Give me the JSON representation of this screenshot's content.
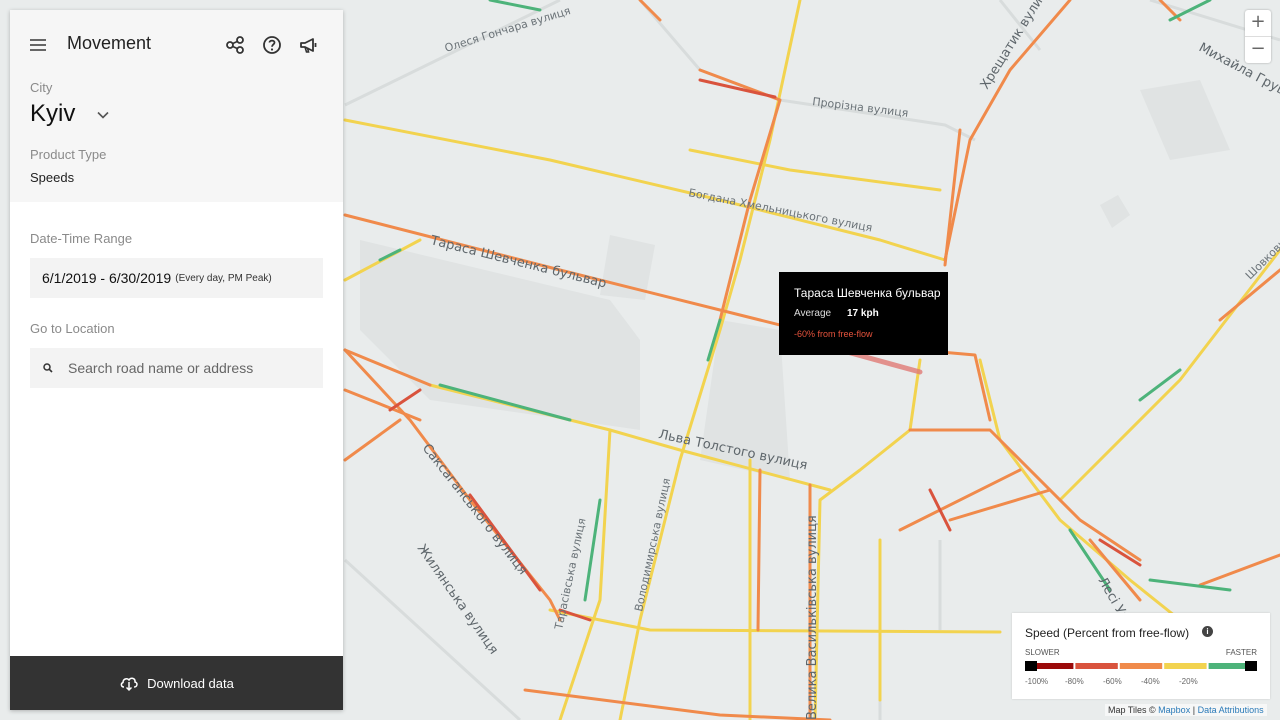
{
  "header": {
    "title": "Movement"
  },
  "city": {
    "label": "City",
    "value": "Kyiv"
  },
  "product": {
    "label": "Product Type",
    "value": "Speeds"
  },
  "date_range": {
    "label": "Date-Time Range",
    "value": "6/1/2019 - 6/30/2019",
    "detail": "(Every day, PM Peak)"
  },
  "location": {
    "label": "Go to Location",
    "placeholder": "Search road name or address"
  },
  "download": {
    "label": "Download data"
  },
  "zoom": {
    "in": "+",
    "out": "−"
  },
  "tooltip": {
    "road": "Тараса Шевченка бульвар",
    "metric_label": "Average",
    "metric_value": "17 kph",
    "diff": "-60% from free-flow"
  },
  "legend": {
    "title": "Speed (Percent from free-flow)",
    "slower": "SLOWER",
    "faster": "FASTER",
    "ticks": [
      "-100%",
      "-80%",
      "-60%",
      "-40%",
      "-20%"
    ],
    "colors": [
      "#9b0a0a",
      "#d9533d",
      "#f08a4b",
      "#f2d34f",
      "#4db37a"
    ]
  },
  "attribution": {
    "prefix": "Map Tiles ©",
    "mapbox": "Mapbox",
    "sep": "|",
    "data": "Data Attributions"
  },
  "streets": {
    "honchara": "Олеся Гончара вулиця",
    "prorizna": "Прорізна вулиця",
    "khreshchatyk": "Хрещатик вулиця",
    "hrushevskoho": "Михайла Грушевського",
    "khmelnytskoho": "Богдана Хмельницького вулиця",
    "shevchenka": "Тараса Шевченка бульвар",
    "tolstoho": "Льва Толстого вулиця",
    "saksahanskoho": "Саксаганського вулиця",
    "zhylianska": "Жилянська вулиця",
    "tarasivska": "Тарасівська вулиця",
    "volodymyrska": "Володимирська вулиця",
    "chervonoarmiiska": "Велика Васильківська вулиця",
    "lesi": "Лесі Українки",
    "shovkovychna": "Шовковична"
  }
}
